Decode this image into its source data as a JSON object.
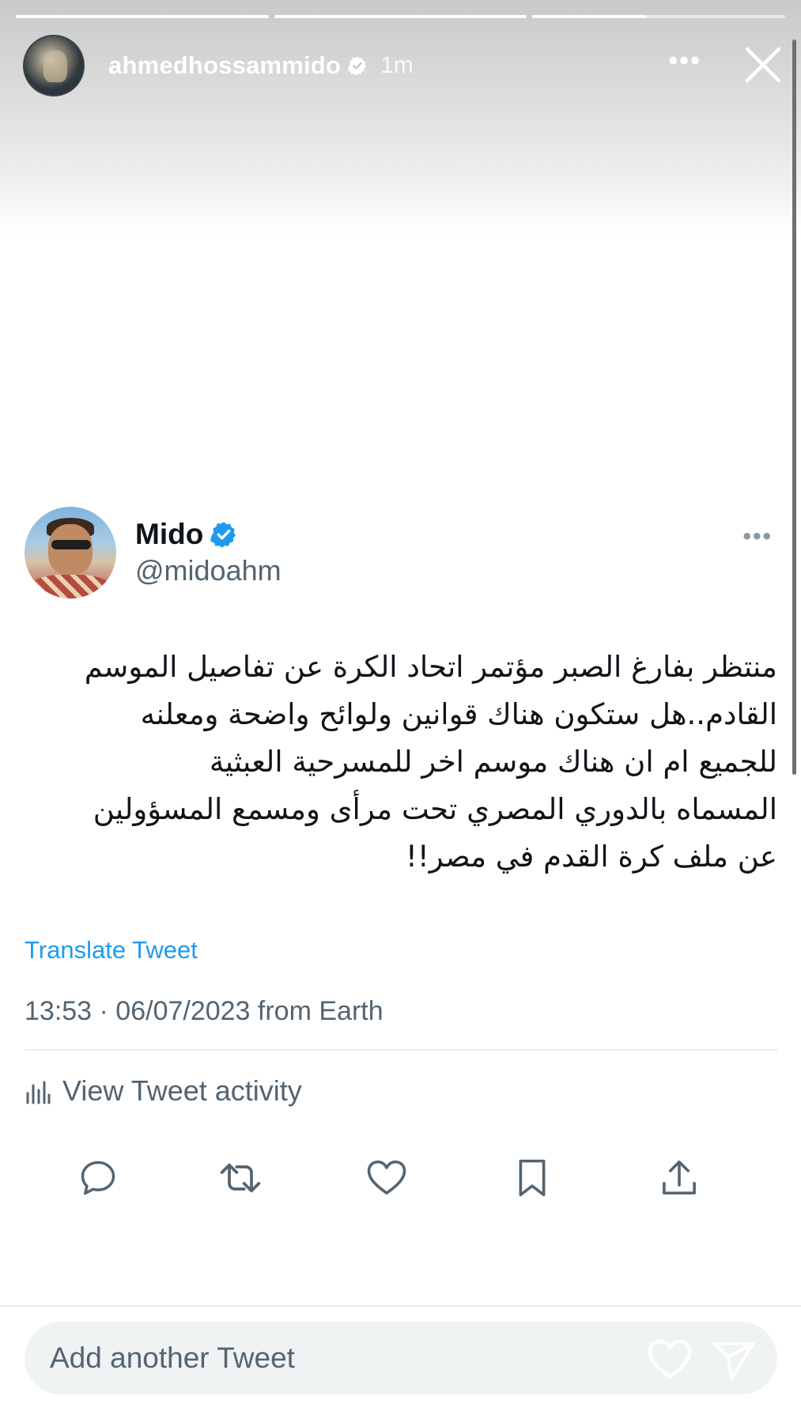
{
  "story": {
    "username": "ahmedhossammido",
    "time": "1m",
    "more_label": "•••",
    "progress": [
      1.0,
      1.0,
      0.45
    ],
    "white": "#ffffff"
  },
  "tweet": {
    "name": "Mido",
    "handle": "@midoahm",
    "more_label": "•••",
    "text_lines": [
      "منتظر بفارغ الصبر مؤتمر اتحاد الكرة عن تفاصيل الموسم",
      "القادم..هل ستكون هناك قوانين ولوائح واضحة ومعلنه",
      "للجميع ام ان هناك موسم اخر للمسرحية العبثية",
      "المسماه بالدوري المصري تحت مرأى ومسمع المسؤولين",
      "عن ملف كرة القدم في مصر!!"
    ],
    "translate_label": "Translate Tweet",
    "timestamp": "13:53 · 06/07/2023 from Earth",
    "activity_label": "View Tweet activity",
    "verified_color": "#1d9bf0",
    "icons": [
      "reply-icon",
      "retweet-icon",
      "like-icon",
      "bookmark-icon",
      "share-icon"
    ]
  },
  "reply": {
    "placeholder": "Add another Tweet"
  }
}
